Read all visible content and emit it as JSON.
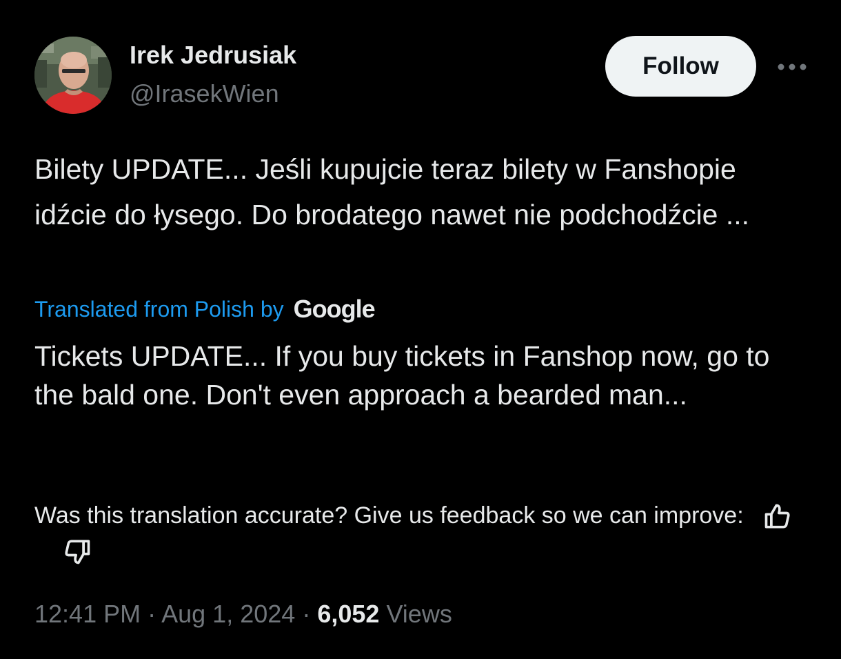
{
  "author": {
    "display_name": "Irek Jedrusiak",
    "handle": "@IrasekWien",
    "avatar_icon": "profile-photo"
  },
  "header": {
    "follow_label": "Follow",
    "more_icon": "more-horizontal-icon"
  },
  "tweet": {
    "text": "Bilety UPDATE... Jeśli kupujcie teraz bilety w Fanshopie idźcie do łysego. Do brodatego nawet nie podchodźcie ...",
    "translation_label": "Translated from Polish by",
    "translation_provider": "Google",
    "translated_text": "Tickets UPDATE... If you buy tickets in Fanshop now, go to the bald one. Don't even approach a bearded man..."
  },
  "feedback": {
    "prompt": "Was this translation accurate? Give us feedback so we can improve:",
    "thumbs_up_icon": "thumbs-up-icon",
    "thumbs_down_icon": "thumbs-down-icon"
  },
  "meta": {
    "time": "12:41 PM",
    "separator": "·",
    "date": "Aug 1, 2024",
    "views_count": "6,052",
    "views_label": "Views"
  },
  "colors": {
    "background": "#000000",
    "text_primary": "#e7e9ea",
    "text_secondary": "#71767b",
    "link": "#1d9bf0",
    "follow_bg": "#eff3f4"
  }
}
